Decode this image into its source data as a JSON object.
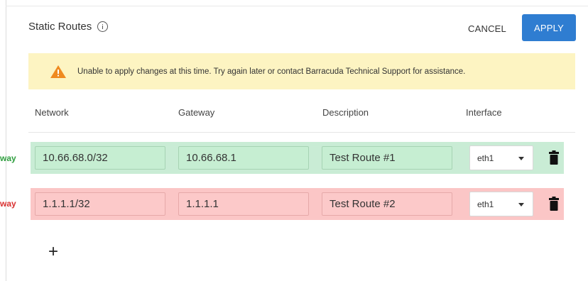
{
  "header": {
    "title": "Static Routes",
    "cancel_label": "CANCEL",
    "apply_label": "APPLY"
  },
  "warning": {
    "icon": "warning-triangle-icon",
    "text": "Unable to apply changes at this time. Try again later or contact Barracuda Technical Support for assistance."
  },
  "columns": {
    "network": "Network",
    "gateway": "Gateway",
    "description": "Description",
    "interface": "Interface"
  },
  "side_labels": {
    "row1": "way",
    "row2": "way"
  },
  "routes": [
    {
      "network": "10.66.68.0/32",
      "gateway": "10.66.68.1",
      "description": "Test Route #1",
      "interface": "eth1",
      "status": "success"
    },
    {
      "network": "1.1.1.1/32",
      "gateway": "1.1.1.1",
      "description": "Test Route #2",
      "interface": "eth1",
      "status": "error"
    }
  ],
  "add_label": "+",
  "colors": {
    "accent": "#2f7dd1",
    "warning_bg": "#fdf4c2",
    "success_row": "#c9ecd5",
    "error_row": "#fbc6c6",
    "success_text": "#2e9e3e",
    "error_text": "#d93030"
  }
}
